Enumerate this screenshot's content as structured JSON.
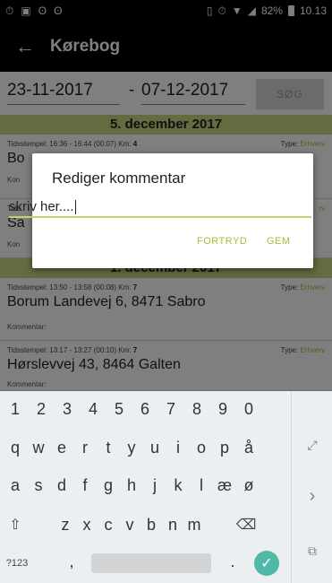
{
  "status_bar": {
    "battery": "82%",
    "time": "10.13",
    "icons": [
      "alarm-icon",
      "image-icon",
      "hotspot-icon",
      "hotspot-icon",
      "vibrate-icon",
      "alarm-icon",
      "wifi-icon",
      "signal-icon",
      "battery-icon"
    ]
  },
  "app_bar": {
    "title": "Kørebog"
  },
  "date_range": {
    "from": "23-11-2017",
    "separator": "-",
    "to": "07-12-2017",
    "search_label": "SØG"
  },
  "list": {
    "day_headers": [
      "5. december 2017",
      "1. december 2017"
    ],
    "entries": [
      {
        "meta_prefix": "Tidsstempel: ",
        "time": "16:36 - 16:44 (00:07)",
        "km_label": "Km:",
        "km": "4",
        "type_label": "Type:",
        "type": "Erhverv",
        "address": "Bo",
        "comment": "Kon"
      },
      {
        "meta_prefix": "Tids",
        "address": "Sa",
        "comment": "Kon",
        "type": "rv"
      },
      {
        "meta_prefix": "Tidsstempel: ",
        "time": "13:50 - 13:58 (00:08)",
        "km_label": "Km:",
        "km": "7",
        "type_label": "Type:",
        "type": "Erhverv",
        "address": "Borum Landevej 6, 8471 Sabro",
        "comment": "Kommentar:"
      },
      {
        "meta_prefix": "Tidsstempel: ",
        "time": "13:17 - 13:27 (00:10)",
        "km_label": "Km:",
        "km": "7",
        "type_label": "Type:",
        "type": "Erhverv",
        "address": "Hørslevvej 43, 8464 Galten",
        "comment": "Kommentar:"
      }
    ]
  },
  "dialog": {
    "title": "Rediger kommentar",
    "input_value": "skriv her....",
    "cancel_label": "FORTRYD",
    "ok_label": "GEM"
  },
  "keyboard": {
    "row_numbers": [
      "1",
      "2",
      "3",
      "4",
      "5",
      "6",
      "7",
      "8",
      "9",
      "0"
    ],
    "row1": [
      "q",
      "w",
      "e",
      "r",
      "t",
      "y",
      "u",
      "i",
      "o",
      "p",
      "å"
    ],
    "row2": [
      "a",
      "s",
      "d",
      "f",
      "g",
      "h",
      "j",
      "k",
      "l",
      "æ",
      "ø"
    ],
    "row3": [
      "z",
      "x",
      "c",
      "v",
      "b",
      "n",
      "m"
    ],
    "symbols_label": "?123",
    "comma": ",",
    "period": "."
  }
}
